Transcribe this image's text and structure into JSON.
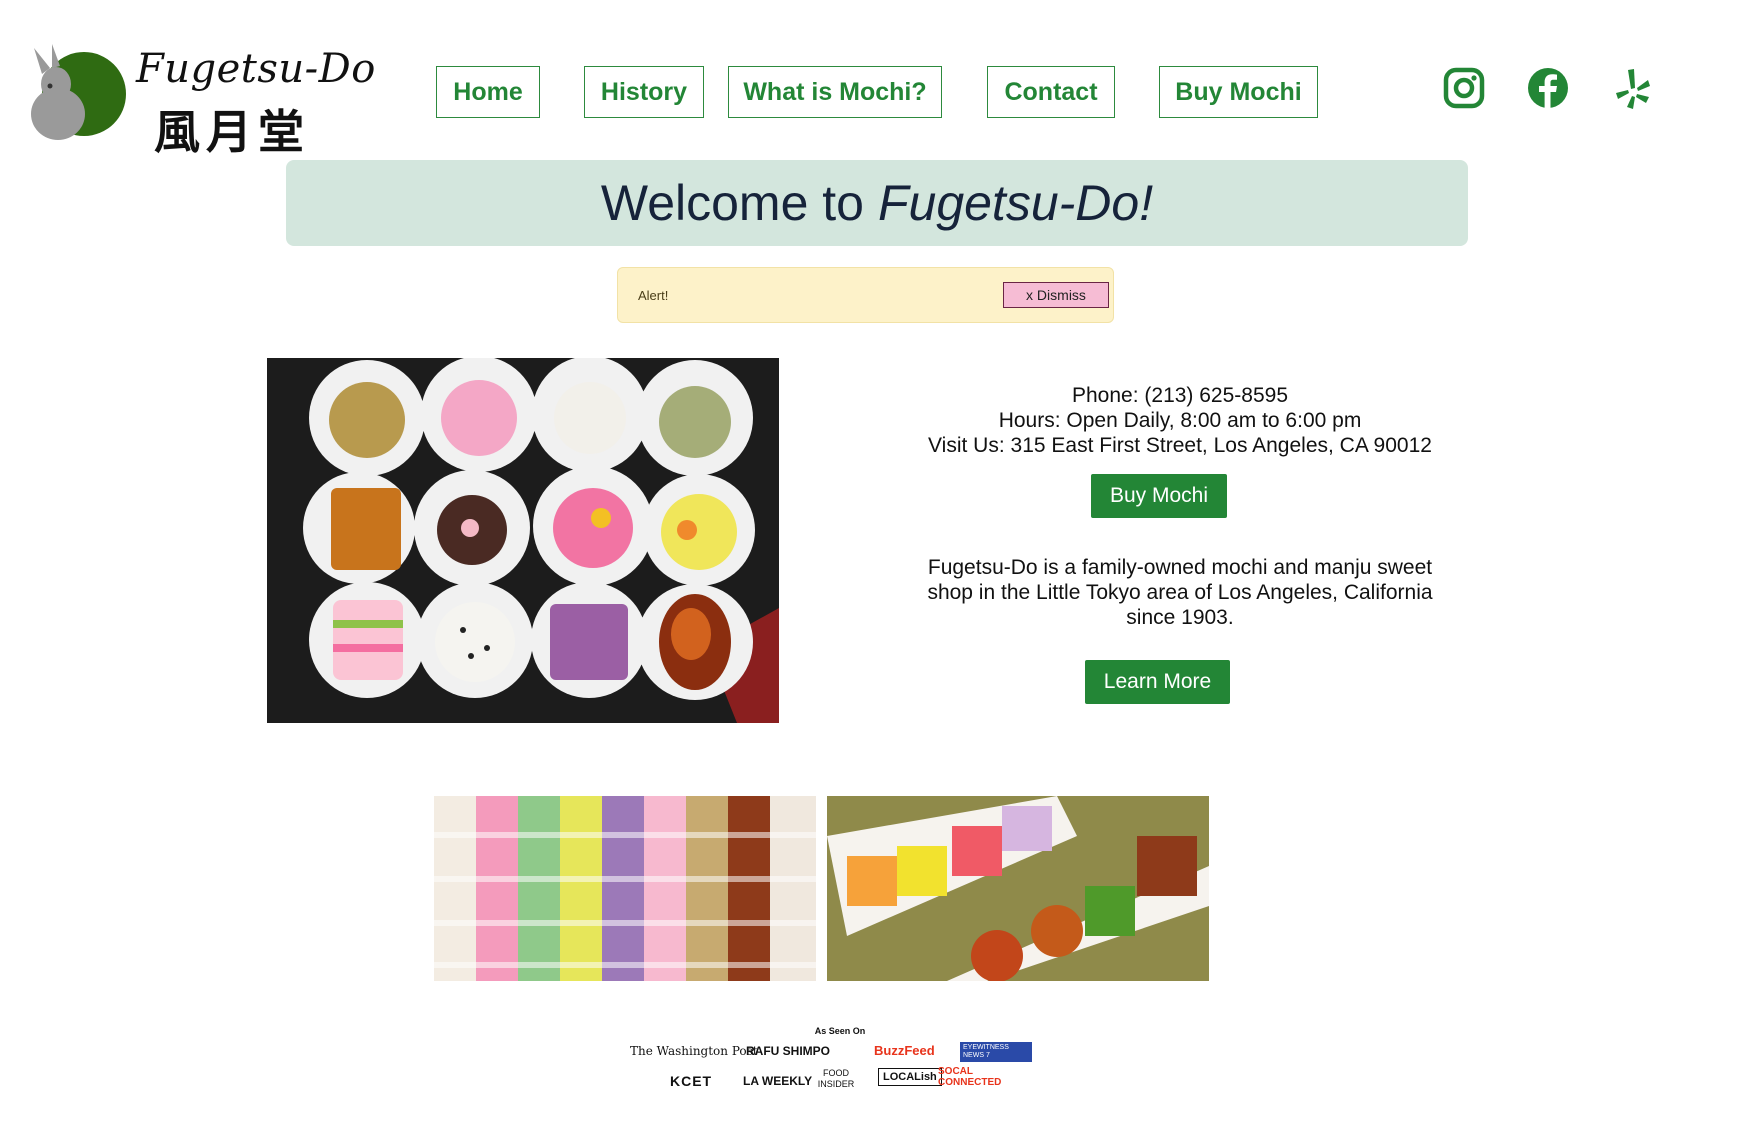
{
  "header": {
    "logo_text": "Fugetsu-Do",
    "logo_kanji": "風月堂",
    "nav": [
      {
        "label": "Home"
      },
      {
        "label": "History"
      },
      {
        "label": "What is Mochi?"
      },
      {
        "label": "Contact"
      },
      {
        "label": "Buy Mochi"
      }
    ],
    "social": [
      {
        "icon": "instagram-icon"
      },
      {
        "icon": "facebook-icon"
      },
      {
        "icon": "yelp-icon"
      }
    ]
  },
  "welcome": {
    "prefix": "Welcome to",
    "name": "Fugetsu-Do!"
  },
  "alert": {
    "text": "Alert!",
    "dismiss_label": "x Dismiss"
  },
  "contact": {
    "phone": "Phone: (213) 625-8595",
    "hours": "Hours: Open Daily, 8:00 am to 6:00 pm",
    "address": "Visit Us: 315 East First Street, Los Angeles, CA 90012",
    "buy_label": "Buy Mochi"
  },
  "about": {
    "line1": "Fugetsu-Do is a family-owned mochi and manju sweet",
    "line2": "shop in the Little Tokyo area of Los Angeles, California",
    "line3": "since 1903.",
    "learn_label": "Learn More"
  },
  "press": {
    "title": "As Seen On",
    "row1": [
      "The Washington Post",
      "RAFU SHIMPO",
      "BuzzFeed",
      "EYEWITNESS NEWS 7"
    ],
    "row2": [
      "KCET",
      "LA WEEKLY",
      "FOOD INSIDER",
      "LOCALish",
      "SOCAL CONNECTED"
    ]
  },
  "colors": {
    "brand_green": "#238636",
    "banner_bg": "#d3e6dd",
    "alert_bg": "#fdf2c9",
    "dismiss_bg": "#f6bcd4"
  }
}
